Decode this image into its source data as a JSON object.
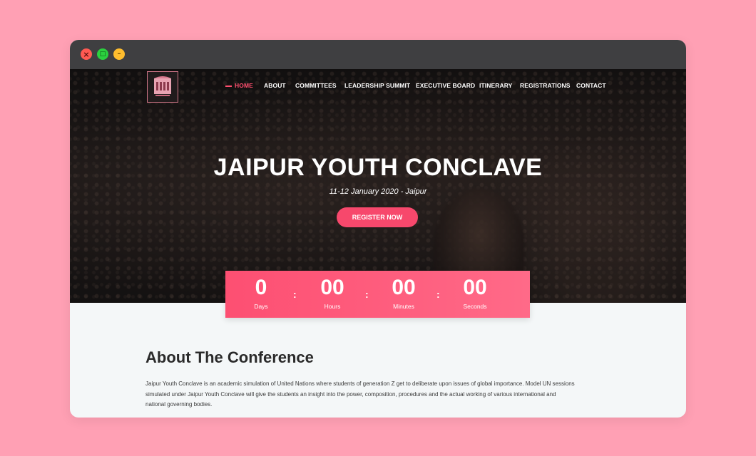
{
  "window": {
    "controls": {
      "close_icon": "close-icon",
      "maximize_icon": "maximize-icon",
      "minimize_icon": "minimize-icon"
    }
  },
  "nav": {
    "items": [
      {
        "label": "HOME",
        "active": true
      },
      {
        "label": "ABOUT",
        "active": false
      },
      {
        "label": "COMMITTEES",
        "active": false
      },
      {
        "label": "LEADERSHIP SUMMIT",
        "active": false
      },
      {
        "label": "EXECUTIVE BOARD",
        "active": false
      },
      {
        "label": "ITINERARY",
        "active": false
      },
      {
        "label": "REGISTRATIONS",
        "active": false
      },
      {
        "label": "CONTACT",
        "active": false
      }
    ]
  },
  "hero": {
    "title": "JAIPUR YOUTH CONCLAVE",
    "subtitle": "11-12 January 2020 - Jaipur",
    "register_label": "REGISTER NOW"
  },
  "countdown": {
    "days": {
      "value": "0",
      "label": "Days"
    },
    "hours": {
      "value": "00",
      "label": "Hours"
    },
    "minutes": {
      "value": "00",
      "label": "Minutes"
    },
    "seconds": {
      "value": "00",
      "label": "Seconds"
    },
    "separator": ":"
  },
  "about": {
    "heading": "About The Conference",
    "lines": [
      "Jaipur Youth Conclave is an academic simulation of United Nations where students of generation Z get to deliberate upon issues of global importance. Model UN sessions",
      "simulated under Jaipur Youth Conclave will give the students an insight into the power, composition, procedures and the actual working of various international and",
      "national governing bodies."
    ]
  },
  "colors": {
    "background": "#ffa0b4",
    "accent": "#f7486c",
    "titlebar": "#3f3f41"
  }
}
